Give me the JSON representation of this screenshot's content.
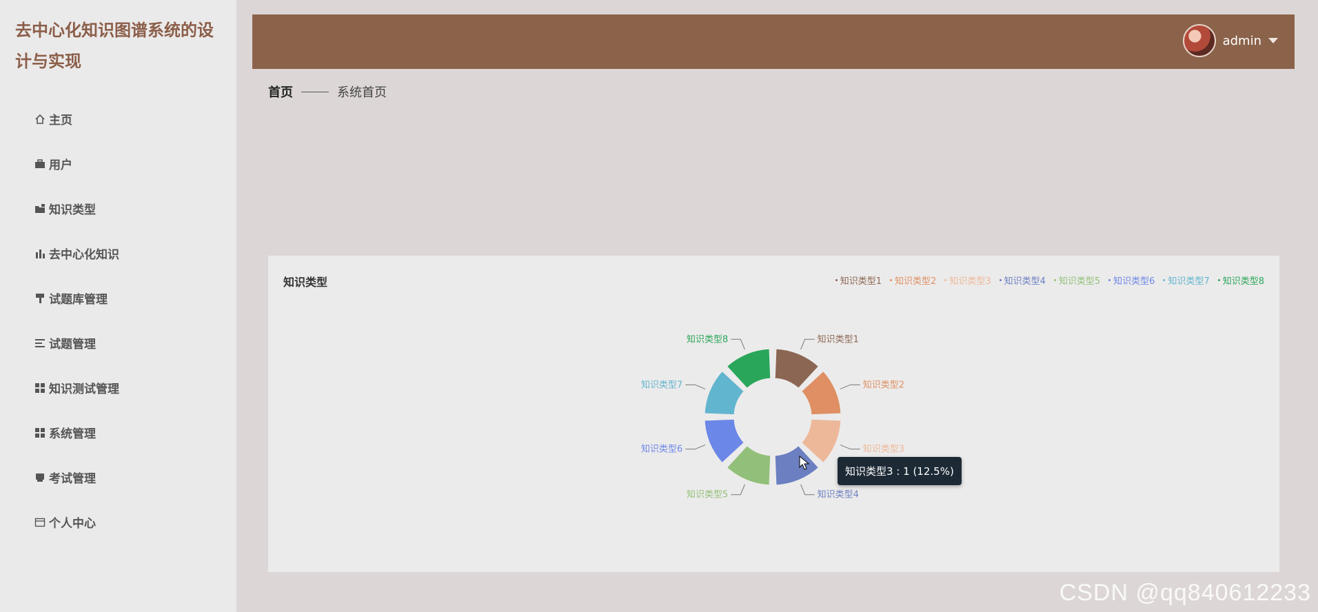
{
  "app": {
    "title": "去中心化知识图谱系统的设计与实现"
  },
  "sidebar": {
    "items": [
      {
        "label": "主页",
        "icon": "home-icon"
      },
      {
        "label": "用户",
        "icon": "briefcase-icon"
      },
      {
        "label": "知识类型",
        "icon": "folder-icon"
      },
      {
        "label": "去中心化知识",
        "icon": "bar-chart-icon"
      },
      {
        "label": "试题库管理",
        "icon": "paint-roller-icon"
      },
      {
        "label": "试题管理",
        "icon": "list-icon"
      },
      {
        "label": "知识测试管理",
        "icon": "grid-icon"
      },
      {
        "label": "系统管理",
        "icon": "grid-icon"
      },
      {
        "label": "考试管理",
        "icon": "printer-icon"
      },
      {
        "label": "个人中心",
        "icon": "card-icon"
      }
    ]
  },
  "header": {
    "username": "admin"
  },
  "breadcrumb": {
    "home": "首页",
    "current": "系统首页"
  },
  "card": {
    "title": "知识类型"
  },
  "tooltip": {
    "text": "知识类型3 : 1 (12.5%)"
  },
  "watermark": "CSDN @qq840612233",
  "chart_data": {
    "type": "pie",
    "title": "知识类型",
    "donut": true,
    "legend_position": "top-right",
    "categories": [
      "知识类型1",
      "知识类型2",
      "知识类型3",
      "知识类型4",
      "知识类型5",
      "知识类型6",
      "知识类型7",
      "知识类型8"
    ],
    "values": [
      1,
      1,
      1,
      1,
      1,
      1,
      1,
      1
    ],
    "colors": [
      "#8b6653",
      "#df8f63",
      "#edb89a",
      "#6b7fc1",
      "#92c07a",
      "#6b87e8",
      "#62b5cf",
      "#2aa65a"
    ]
  }
}
